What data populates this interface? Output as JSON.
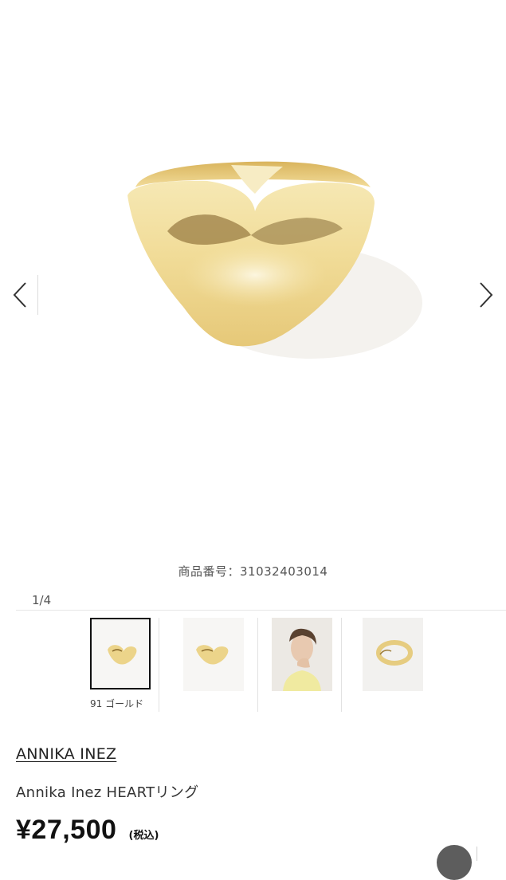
{
  "gallery": {
    "counter": "1/4",
    "product_code_label": "商品番号：31032403014"
  },
  "thumbnails": [
    {
      "caption": "91 ゴールド",
      "selected": true,
      "icon": "gold-heart-ring"
    },
    {
      "caption": "",
      "selected": false,
      "icon": "gold-heart-ring"
    },
    {
      "caption": "",
      "selected": false,
      "icon": "model-wearing-ring"
    },
    {
      "caption": "",
      "selected": false,
      "icon": "gold-ring-side-view"
    }
  ],
  "product": {
    "brand": "ANNIKA INEZ",
    "name": "Annika Inez HEARTリング",
    "price": "¥27,500",
    "tax_note": "(税込)"
  },
  "colors": {
    "gold_light": "#f3e2a6",
    "gold_mid": "#e2c676",
    "gold_dark": "#b89444",
    "text": "#333333"
  }
}
